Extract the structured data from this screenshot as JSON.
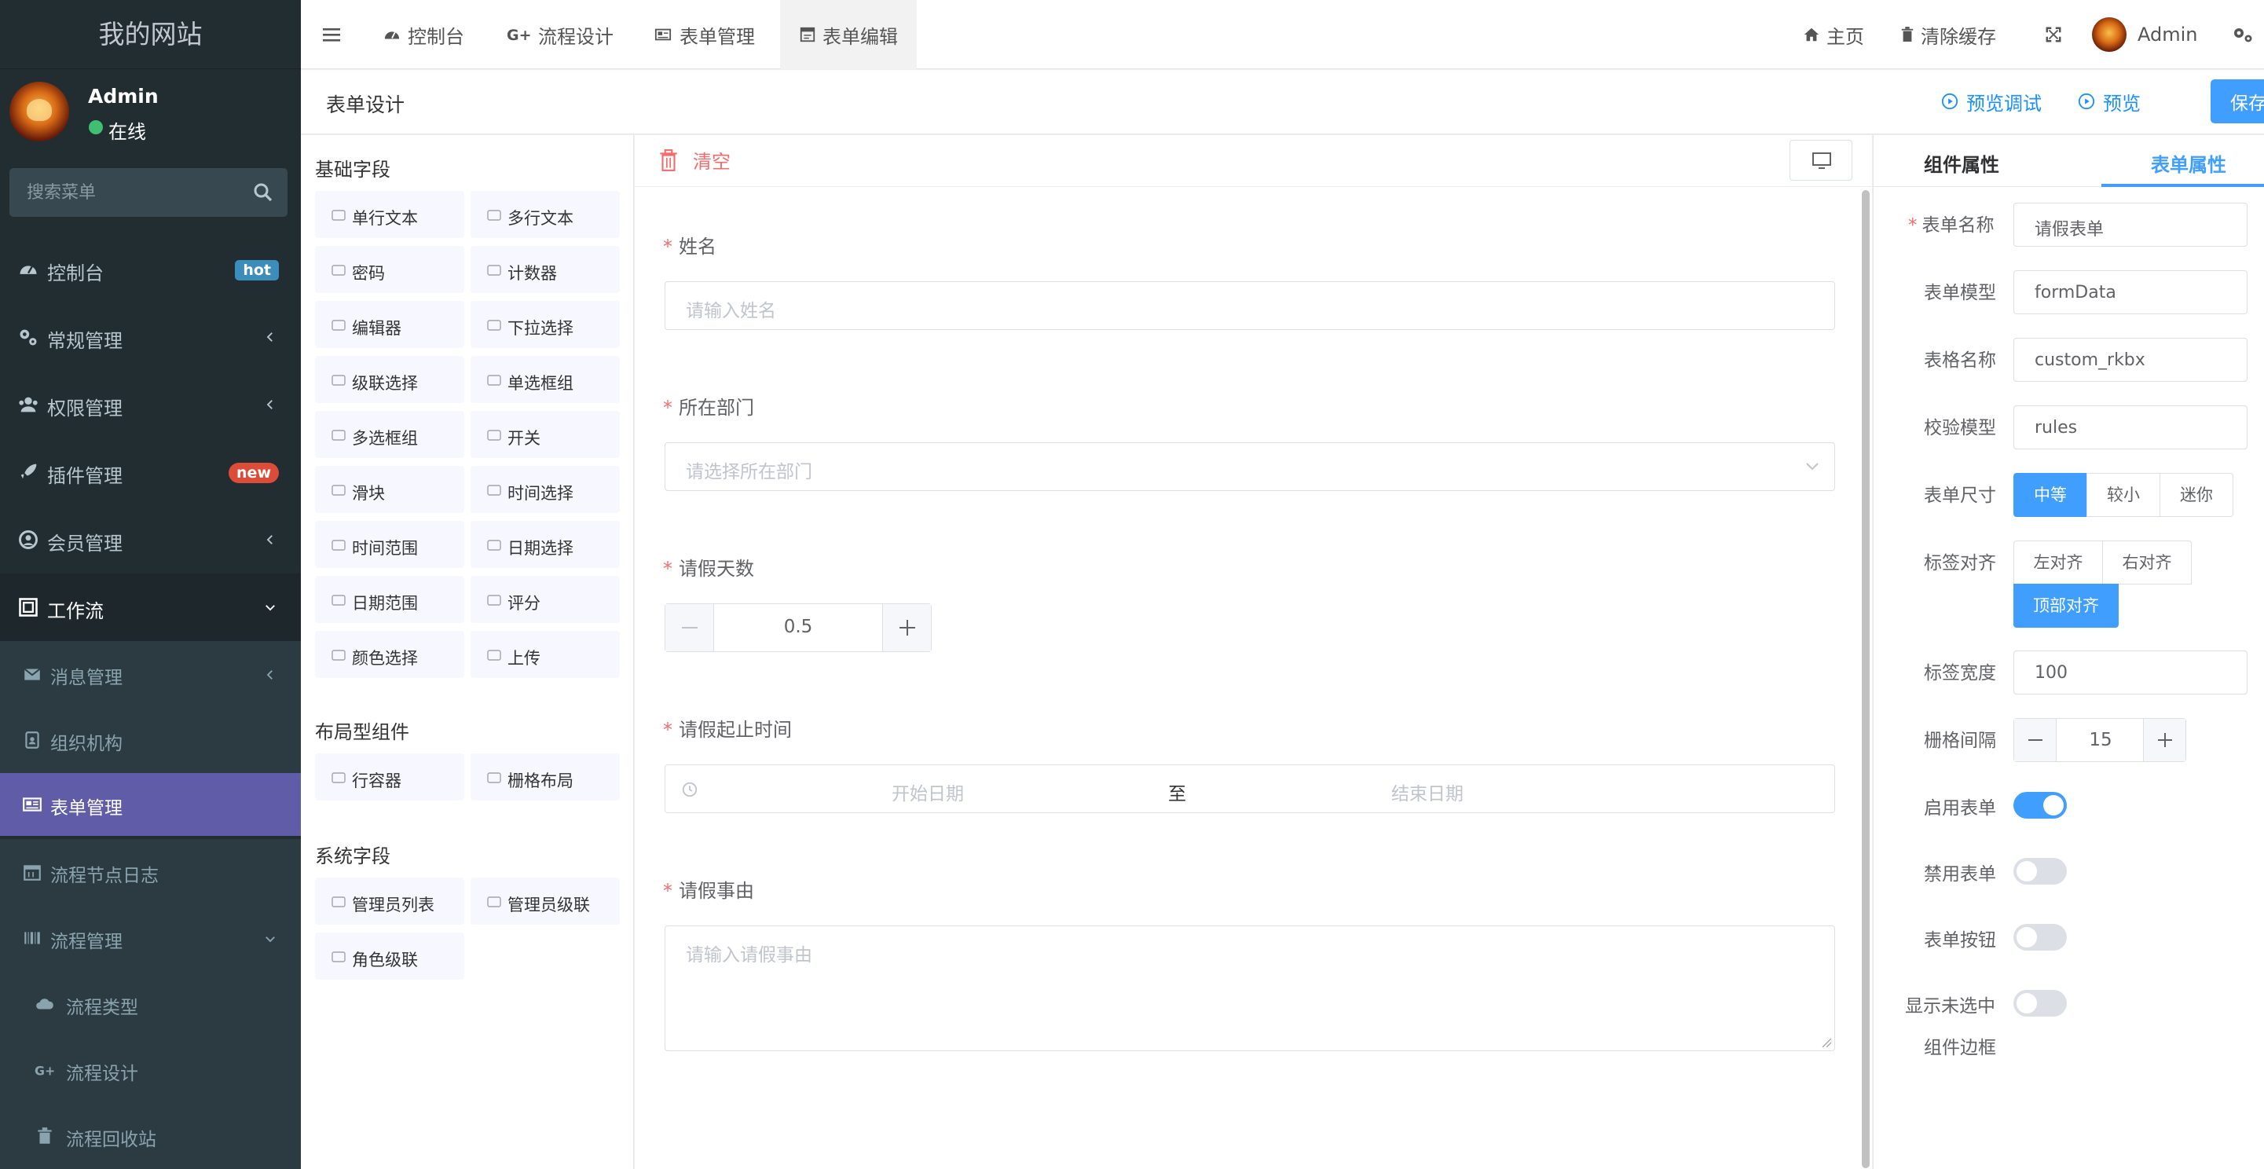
{
  "sidebar": {
    "brand": "我的网站",
    "user": {
      "name": "Admin",
      "status": "在线"
    },
    "search": {
      "placeholder": "搜索菜单"
    },
    "items": [
      {
        "label": "控制台",
        "badge": "hot"
      },
      {
        "label": "常规管理"
      },
      {
        "label": "权限管理"
      },
      {
        "label": "插件管理",
        "badge": "new"
      },
      {
        "label": "会员管理"
      },
      {
        "label": "工作流"
      }
    ],
    "workflow_children": [
      {
        "label": "消息管理"
      },
      {
        "label": "组织机构"
      },
      {
        "label": "表单管理"
      },
      {
        "label": "流程节点日志"
      },
      {
        "label": "流程管理"
      },
      {
        "label": "流程类型"
      },
      {
        "label": "流程设计"
      },
      {
        "label": "流程回收站"
      }
    ]
  },
  "topbar": {
    "tabs": [
      "控制台",
      "流程设计",
      "表单管理",
      "表单编辑"
    ],
    "home": "主页",
    "clear_cache": "清除缓存",
    "user": "Admin"
  },
  "header": {
    "title": "表单设计",
    "preview_debug": "预览调试",
    "preview": "预览",
    "save": "保存"
  },
  "palette": {
    "basic_title": "基础字段",
    "basic": [
      "单行文本",
      "多行文本",
      "密码",
      "计数器",
      "编辑器",
      "下拉选择",
      "级联选择",
      "单选框组",
      "多选框组",
      "开关",
      "滑块",
      "时间选择",
      "时间范围",
      "日期选择",
      "日期范围",
      "评分",
      "颜色选择",
      "上传"
    ],
    "layout_title": "布局型组件",
    "layout": [
      "行容器",
      "栅格布局"
    ],
    "system_title": "系统字段",
    "system": [
      "管理员列表",
      "管理员级联",
      "角色级联"
    ]
  },
  "canvas": {
    "clear": "清空",
    "fields": {
      "name": {
        "label": "姓名",
        "placeholder": "请输入姓名"
      },
      "dept": {
        "label": "所在部门",
        "placeholder": "请选择所在部门"
      },
      "days": {
        "label": "请假天数",
        "value": "0.5"
      },
      "range": {
        "label": "请假起止时间",
        "start": "开始日期",
        "sep": "至",
        "end": "结束日期"
      },
      "reason": {
        "label": "请假事由",
        "placeholder": "请输入请假事由"
      }
    }
  },
  "props": {
    "tab_component": "组件属性",
    "tab_form": "表单属性",
    "form_name": {
      "label": "表单名称",
      "value": "请假表单"
    },
    "form_model": {
      "label": "表单模型",
      "value": "formData"
    },
    "table_name": {
      "label": "表格名称",
      "value": "custom_rkbx"
    },
    "rules_model": {
      "label": "校验模型",
      "value": "rules"
    },
    "size": {
      "label": "表单尺寸",
      "options": [
        "中等",
        "较小",
        "迷你"
      ],
      "selected": "中等"
    },
    "align": {
      "label": "标签对齐",
      "options": [
        "左对齐",
        "右对齐",
        "顶部对齐"
      ],
      "selected": "顶部对齐"
    },
    "label_width": {
      "label": "标签宽度",
      "value": "100"
    },
    "gutter": {
      "label": "栅格间隔",
      "value": "15"
    },
    "enable_form": {
      "label": "启用表单",
      "on": true
    },
    "disable_form": {
      "label": "禁用表单",
      "on": false
    },
    "form_buttons": {
      "label": "表单按钮",
      "on": false
    },
    "show_border": {
      "label_line1": "显示未选中",
      "label_line2": "组件边框",
      "on": false
    }
  },
  "colors": {
    "sidebar_bg": "#222d32",
    "accent": "#409eff",
    "active_menu": "#605ca8",
    "danger": "#f56c6c"
  }
}
